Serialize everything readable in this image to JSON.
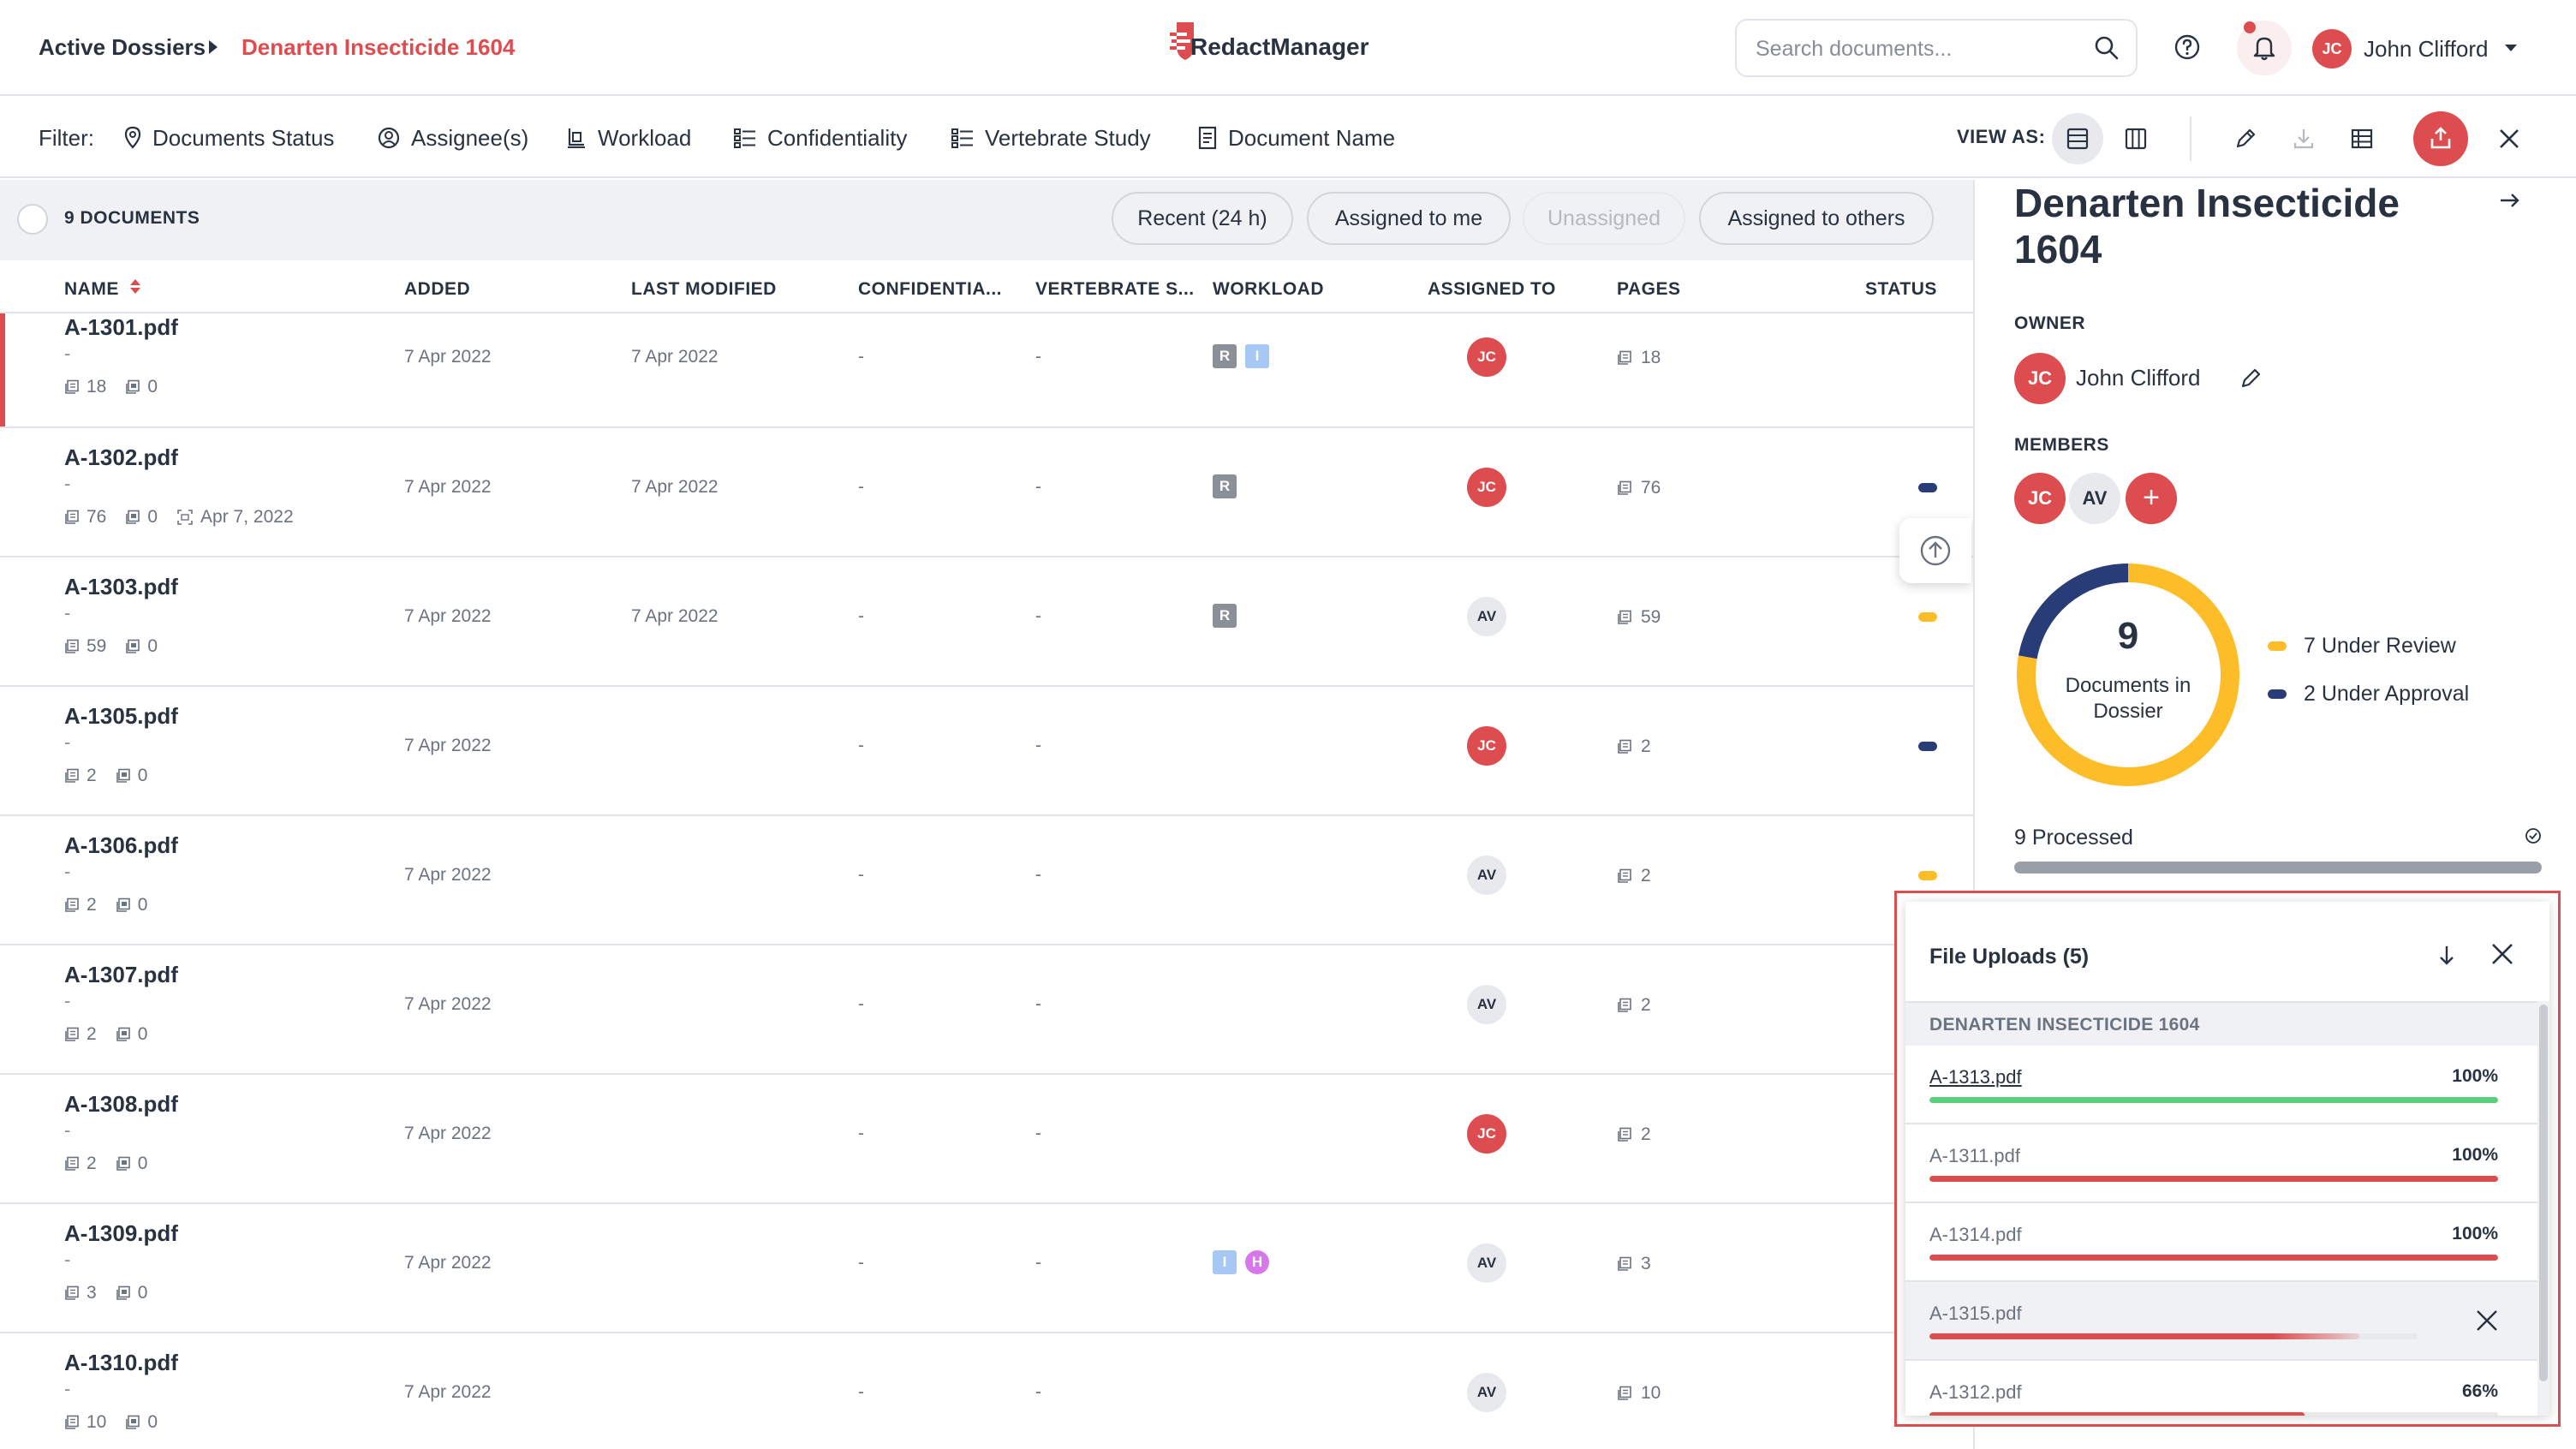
{
  "header": {
    "breadcrumb_root": "Active Dossiers",
    "breadcrumb_current": "Denarten Insecticide 1604",
    "logo_text": "RedactManager",
    "search_placeholder": "Search documents...",
    "user_initials": "JC",
    "user_name": "John Clifford"
  },
  "filterbar": {
    "label": "Filter:",
    "filters": [
      "Documents Status",
      "Assignee(s)",
      "Workload",
      "Confidentiality",
      "Vertebrate Study",
      "Document Name"
    ],
    "view_as": "VIEW AS:"
  },
  "table": {
    "doc_count": "9 DOCUMENTS",
    "chips": [
      "Recent (24 h)",
      "Assigned to me",
      "Unassigned",
      "Assigned to others"
    ],
    "columns": [
      "NAME",
      "ADDED",
      "LAST MODIFIED",
      "CONFIDENTIA...",
      "VERTEBRATE S...",
      "WORKLOAD",
      "ASSIGNED TO",
      "PAGES",
      "STATUS"
    ],
    "rows": [
      {
        "name": "A-1301.pdf",
        "sub": "-",
        "meta_pages": "18",
        "meta_annot": "0",
        "meta_date": "",
        "added": "7 Apr 2022",
        "modified": "7 Apr 2022",
        "conf": "-",
        "vert": "-",
        "workload": [
          "R",
          "I"
        ],
        "assigned": "JC",
        "pages": "18",
        "status": ""
      },
      {
        "name": "A-1302.pdf",
        "sub": "-",
        "meta_pages": "76",
        "meta_annot": "0",
        "meta_date": "Apr 7, 2022",
        "added": "7 Apr 2022",
        "modified": "7 Apr 2022",
        "conf": "-",
        "vert": "-",
        "workload": [
          "R"
        ],
        "assigned": "JC",
        "pages": "76",
        "status": "approval"
      },
      {
        "name": "A-1303.pdf",
        "sub": "-",
        "meta_pages": "59",
        "meta_annot": "0",
        "meta_date": "",
        "added": "7 Apr 2022",
        "modified": "7 Apr 2022",
        "conf": "-",
        "vert": "-",
        "workload": [
          "R"
        ],
        "assigned": "AV",
        "pages": "59",
        "status": "review"
      },
      {
        "name": "A-1305.pdf",
        "sub": "-",
        "meta_pages": "2",
        "meta_annot": "0",
        "meta_date": "",
        "added": "7 Apr 2022",
        "modified": "",
        "conf": "-",
        "vert": "-",
        "workload": [],
        "assigned": "JC",
        "pages": "2",
        "status": "approval"
      },
      {
        "name": "A-1306.pdf",
        "sub": "-",
        "meta_pages": "2",
        "meta_annot": "0",
        "meta_date": "",
        "added": "7 Apr 2022",
        "modified": "",
        "conf": "-",
        "vert": "-",
        "workload": [],
        "assigned": "AV",
        "pages": "2",
        "status": "review"
      },
      {
        "name": "A-1307.pdf",
        "sub": "-",
        "meta_pages": "2",
        "meta_annot": "0",
        "meta_date": "",
        "added": "7 Apr 2022",
        "modified": "",
        "conf": "-",
        "vert": "-",
        "workload": [],
        "assigned": "AV",
        "pages": "2",
        "status": ""
      },
      {
        "name": "A-1308.pdf",
        "sub": "-",
        "meta_pages": "2",
        "meta_annot": "0",
        "meta_date": "",
        "added": "7 Apr 2022",
        "modified": "",
        "conf": "-",
        "vert": "-",
        "workload": [],
        "assigned": "JC",
        "pages": "2",
        "status": ""
      },
      {
        "name": "A-1309.pdf",
        "sub": "-",
        "meta_pages": "3",
        "meta_annot": "0",
        "meta_date": "",
        "added": "7 Apr 2022",
        "modified": "",
        "conf": "-",
        "vert": "-",
        "workload": [
          "I",
          "H"
        ],
        "assigned": "AV",
        "pages": "3",
        "status": ""
      },
      {
        "name": "A-1310.pdf",
        "sub": "-",
        "meta_pages": "10",
        "meta_annot": "0",
        "meta_date": "",
        "added": "7 Apr 2022",
        "modified": "",
        "conf": "-",
        "vert": "-",
        "workload": [],
        "assigned": "AV",
        "pages": "10",
        "status": ""
      }
    ]
  },
  "panel": {
    "title": "Denarten Insecticide 1604",
    "owner_label": "OWNER",
    "owner_initials": "JC",
    "owner_name": "John Clifford",
    "members_label": "MEMBERS",
    "members": [
      "JC",
      "AV"
    ],
    "add_member": "+",
    "total": "9",
    "total_label": "Documents in Dossier",
    "legend": [
      {
        "label": "7 Under Review",
        "value": 7,
        "color": "#fdbd29"
      },
      {
        "label": "2 Under Approval",
        "value": 2,
        "color": "#283c78"
      }
    ],
    "processed_label": "9 Processed",
    "processed_fraction": 1.0
  },
  "uploads": {
    "title": "File Uploads (5)",
    "group": "DENARTEN INSECTICIDE 1604",
    "items": [
      {
        "name": "A-1313.pdf",
        "pct_text": "100%",
        "progress": 1.0,
        "color": "#5ad17a",
        "link": true
      },
      {
        "name": "A-1311.pdf",
        "pct_text": "100%",
        "progress": 1.0,
        "color": "#dd4d50",
        "link": false
      },
      {
        "name": "A-1314.pdf",
        "pct_text": "100%",
        "progress": 1.0,
        "color": "#dd4d50",
        "link": false
      },
      {
        "name": "A-1315.pdf",
        "pct_text": "",
        "progress": 0.88,
        "color": "#dd4d50",
        "link": false
      },
      {
        "name": "A-1312.pdf",
        "pct_text": "66%",
        "progress": 0.66,
        "color": "#dd4d50",
        "link": false
      }
    ]
  },
  "colors": {
    "accent": "#dd4d50",
    "text": "#283241",
    "muted": "#868e9a",
    "review": "#fdbd29",
    "approval": "#283c78"
  }
}
